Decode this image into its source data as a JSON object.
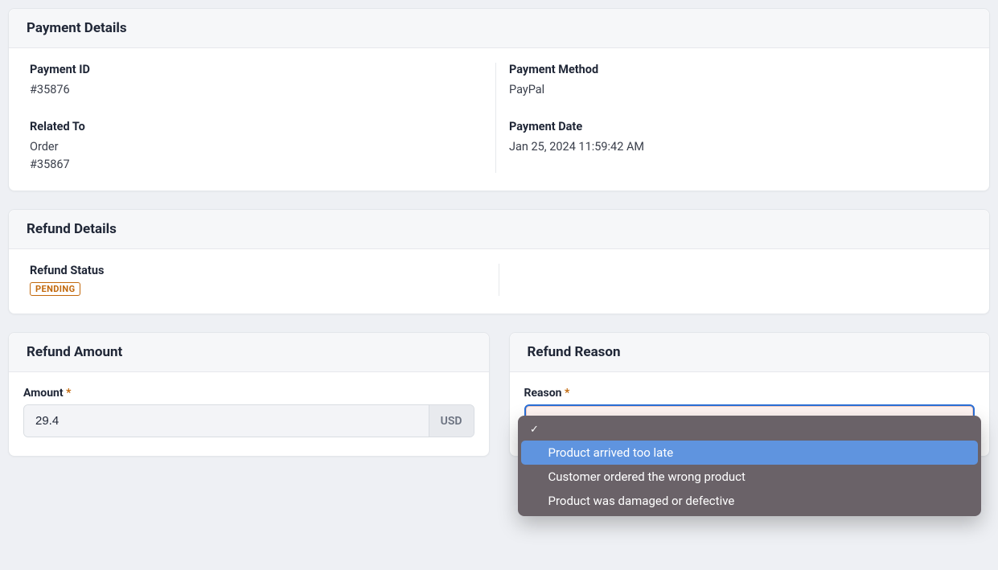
{
  "paymentDetails": {
    "title": "Payment Details",
    "paymentId": {
      "label": "Payment ID",
      "value": "#35876"
    },
    "relatedTo": {
      "label": "Related To",
      "value_line1": "Order",
      "value_line2": "#35867"
    },
    "paymentMethod": {
      "label": "Payment Method",
      "value": "PayPal"
    },
    "paymentDate": {
      "label": "Payment Date",
      "value": "Jan 25, 2024 11:59:42 AM"
    }
  },
  "refundDetails": {
    "title": "Refund Details",
    "status": {
      "label": "Refund Status",
      "badge": "PENDING"
    }
  },
  "refundAmount": {
    "title": "Refund Amount",
    "amount": {
      "label": "Amount",
      "value": "29.4",
      "currency": "USD"
    }
  },
  "refundReason": {
    "title": "Refund Reason",
    "reason": {
      "label": "Reason"
    },
    "dropdown": {
      "blank_check": "✓",
      "options": [
        "Product arrived too late",
        "Customer ordered the wrong product",
        "Product was damaged or defective"
      ]
    }
  },
  "required_marker": "*"
}
